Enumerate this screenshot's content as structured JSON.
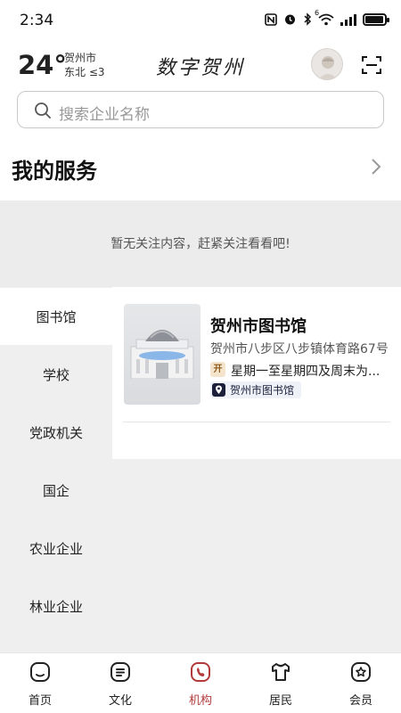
{
  "status_bar": {
    "time": "2:34",
    "icons": [
      "nfc-icon",
      "alarm-icon",
      "bluetooth-icon",
      "wifi-icon",
      "signal-icon",
      "battery-icon"
    ],
    "wifi_label": "6"
  },
  "header": {
    "temperature": "24°",
    "city": "贺州市",
    "wind": "东北 ≤3",
    "app_title": "数字贺州"
  },
  "search": {
    "placeholder": "搜索企业名称"
  },
  "services": {
    "title": "我的服务"
  },
  "empty_state": {
    "text": "暂无关注内容，赶紧关注看看吧!"
  },
  "categories": {
    "active_index": 0,
    "items": [
      {
        "label": "图书馆"
      },
      {
        "label": "学校"
      },
      {
        "label": "党政机关"
      },
      {
        "label": "国企"
      },
      {
        "label": "农业企业"
      },
      {
        "label": "林业企业"
      }
    ]
  },
  "listing": {
    "name": "贺州市图书馆",
    "address": "贺州市八步区八步镇体育路67号",
    "open_badge": "开",
    "hours": "星期一至星期四及周末为...",
    "tag": "贺州市图书馆"
  },
  "bottom_nav": {
    "active_index": 2,
    "accent_color": "#b23a3a",
    "items": [
      {
        "label": "首页",
        "icon": "home-icon"
      },
      {
        "label": "文化",
        "icon": "culture-icon"
      },
      {
        "label": "机构",
        "icon": "institution-icon"
      },
      {
        "label": "居民",
        "icon": "resident-icon"
      },
      {
        "label": "会员",
        "icon": "member-icon"
      }
    ]
  }
}
